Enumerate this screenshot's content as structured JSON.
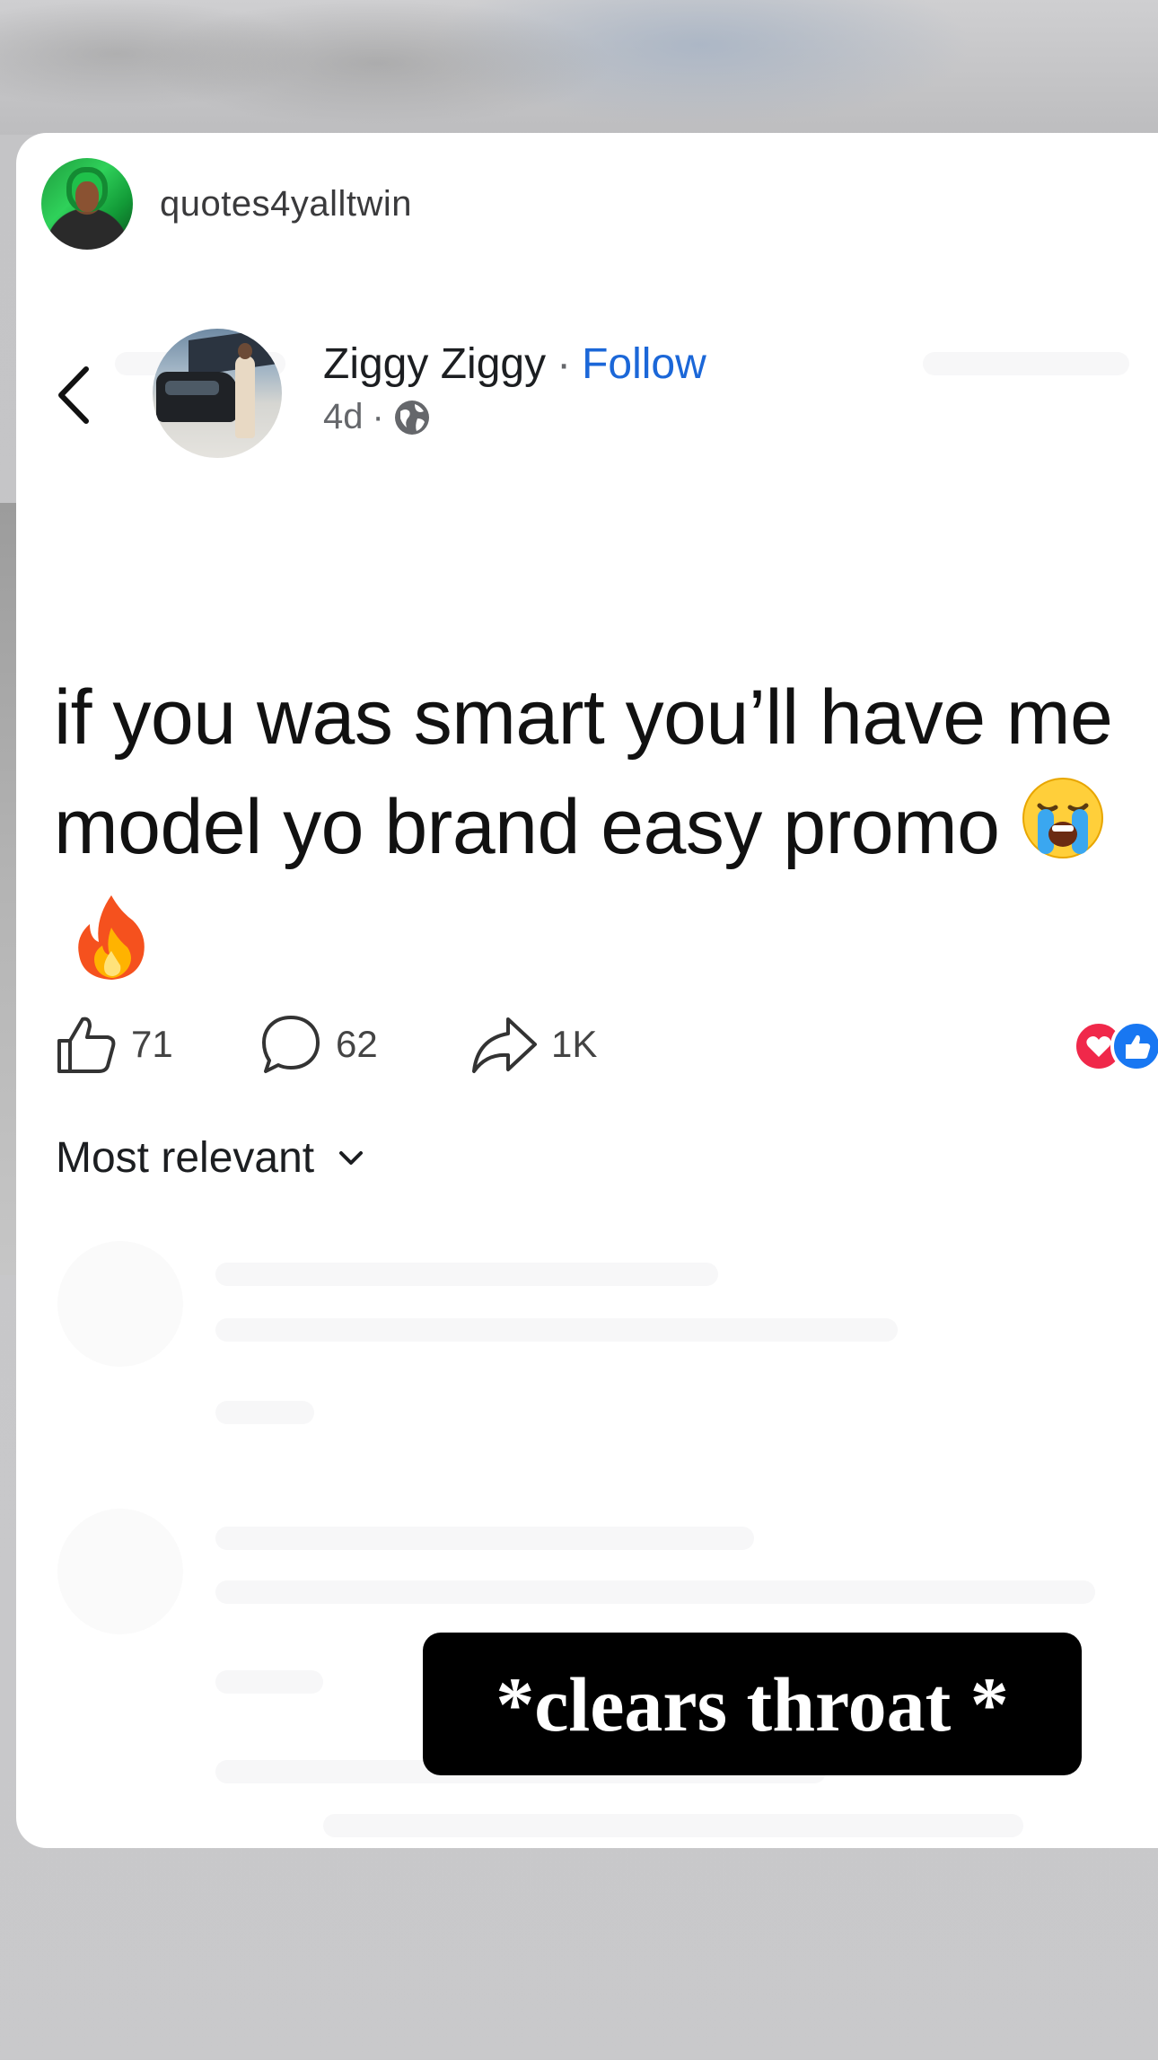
{
  "story": {
    "share_username": "quotes4yalltwin",
    "caption_sticker": "*clears throat *"
  },
  "post": {
    "author_name": "Ziggy Ziggy",
    "separator": "·",
    "follow_label": "Follow",
    "age": "4d",
    "age_separator": "·",
    "privacy_icon": "globe-icon",
    "text": "if you was smart you’ll have me model yo brand easy promo",
    "emojis": [
      "crying-face-emoji",
      "fire-emoji"
    ],
    "likes_count": "71",
    "comments_count": "62",
    "shares_count": "1K",
    "reaction_icons": [
      "heart-reaction-icon",
      "like-reaction-icon"
    ],
    "sort_label": "Most relevant"
  },
  "colors": {
    "follow": "#1b67d8",
    "heart_reaction": "#f0284a",
    "like_reaction": "#1877f2",
    "sticker_bg": "#000000",
    "sticker_text": "#ffffff"
  }
}
